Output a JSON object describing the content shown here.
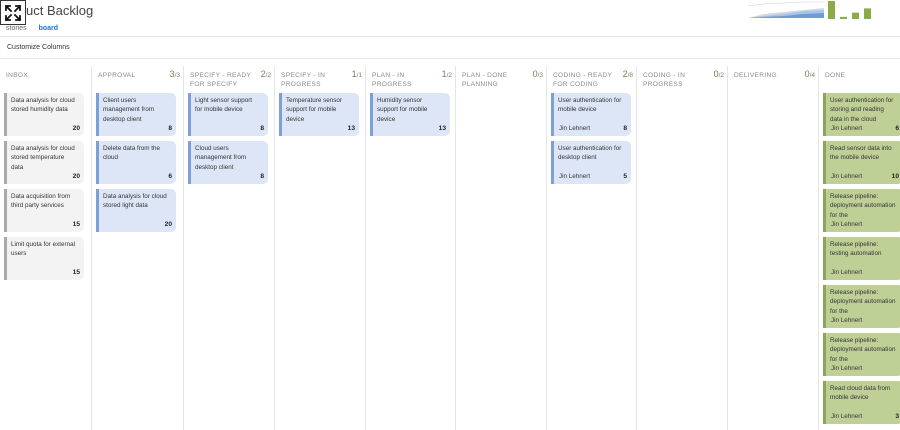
{
  "header": {
    "title_suffix": "uct Backlog",
    "tabs": [
      {
        "label": "stories",
        "active": false
      },
      {
        "label": "board",
        "active": true
      }
    ]
  },
  "toolbar": {
    "customize_label": "Customize Columns"
  },
  "colors": {
    "inbox": "#f3f3f3",
    "blue": "#dde6f6",
    "green": "#bfd097",
    "accent": "#1e72c9"
  },
  "mini_chart": {
    "cfd": {
      "type": "area",
      "series_colors": [
        "#cfd8e6",
        "#a9c4e6",
        "#6d9bd3"
      ]
    },
    "velocity": {
      "type": "bar",
      "values": [
        17,
        2,
        6,
        10
      ]
    }
  },
  "columns": [
    {
      "name": "INBOX",
      "count": "",
      "limit": "",
      "style": "inbox",
      "cards": [
        {
          "title": "Data analysis for cloud stored humidity data",
          "owner": "",
          "estimate": "20"
        },
        {
          "title": "Data analysis for cloud stored temperature data",
          "owner": "",
          "estimate": "20"
        },
        {
          "title": "Data acquisition from third party services",
          "owner": "",
          "estimate": "15"
        },
        {
          "title": "Limit quota for external users",
          "owner": "",
          "estimate": "15"
        }
      ]
    },
    {
      "name": "APPROVAL",
      "count": "3",
      "limit": "/3",
      "style": "blue",
      "cards": [
        {
          "title": "Client users management from desktop client",
          "owner": "",
          "estimate": "8"
        },
        {
          "title": "Delete data from the cloud",
          "owner": "",
          "estimate": "6"
        },
        {
          "title": "Data analysis for cloud stored light data",
          "owner": "",
          "estimate": "20"
        }
      ]
    },
    {
      "name": "SPECIFY - READY FOR SPECIFY",
      "count": "2",
      "limit": "/2",
      "style": "blue",
      "cards": [
        {
          "title": "Light sensor support for mobile device",
          "owner": "",
          "estimate": "8"
        },
        {
          "title": "Cloud users management from desktop client",
          "owner": "",
          "estimate": "8"
        }
      ]
    },
    {
      "name": "SPECIFY - IN PROGRESS",
      "count": "1",
      "limit": "/1",
      "style": "blue",
      "cards": [
        {
          "title": "Temperature sensor support for mobile device",
          "owner": "",
          "estimate": "13"
        }
      ]
    },
    {
      "name": "PLAN - IN PROGRESS",
      "count": "1",
      "limit": "/2",
      "style": "blue",
      "cards": [
        {
          "title": "Humidity sensor support for mobile device",
          "owner": "",
          "estimate": "13"
        }
      ]
    },
    {
      "name": "PLAN - DONE PLANNING",
      "count": "0",
      "limit": "/3",
      "style": "blue",
      "cards": []
    },
    {
      "name": "CODING - READY FOR CODING",
      "count": "2",
      "limit": "/8",
      "style": "blue",
      "cards": [
        {
          "title": "User authentication for mobile device",
          "owner": "Jin Lehnert",
          "estimate": "8"
        },
        {
          "title": "User authentication for desktop client",
          "owner": "Jin Lehnert",
          "estimate": "5"
        }
      ]
    },
    {
      "name": "CODING - IN PROGRESS",
      "count": "0",
      "limit": "/2",
      "style": "blue",
      "cards": []
    },
    {
      "name": "DELIVERING",
      "count": "0",
      "limit": "/4",
      "style": "blue",
      "cards": []
    },
    {
      "name": "DONE",
      "count": "",
      "limit": "",
      "style": "green",
      "cards": [
        {
          "title": "User authentication for storing and reading data in the cloud",
          "owner": "Jin Lehnert",
          "estimate": "6"
        },
        {
          "title": "Read sensor data into the mobile device",
          "owner": "Jin Lehnert",
          "estimate": "10"
        },
        {
          "title": "Release pipeline: deployment automation for the",
          "owner": "Jin Lehnert",
          "estimate": ""
        },
        {
          "title": "Release pipeline: testing automation",
          "owner": "Jin Lehnert",
          "estimate": ""
        },
        {
          "title": "Release pipeline: deployment automation for the",
          "owner": "Jin Lehnert",
          "estimate": ""
        },
        {
          "title": "Release pipeline: deployment automation for the",
          "owner": "Jin Lehnert",
          "estimate": ""
        },
        {
          "title": "Read cloud data from mobile device",
          "owner": "Jin Lehnert",
          "estimate": "3"
        }
      ]
    }
  ]
}
